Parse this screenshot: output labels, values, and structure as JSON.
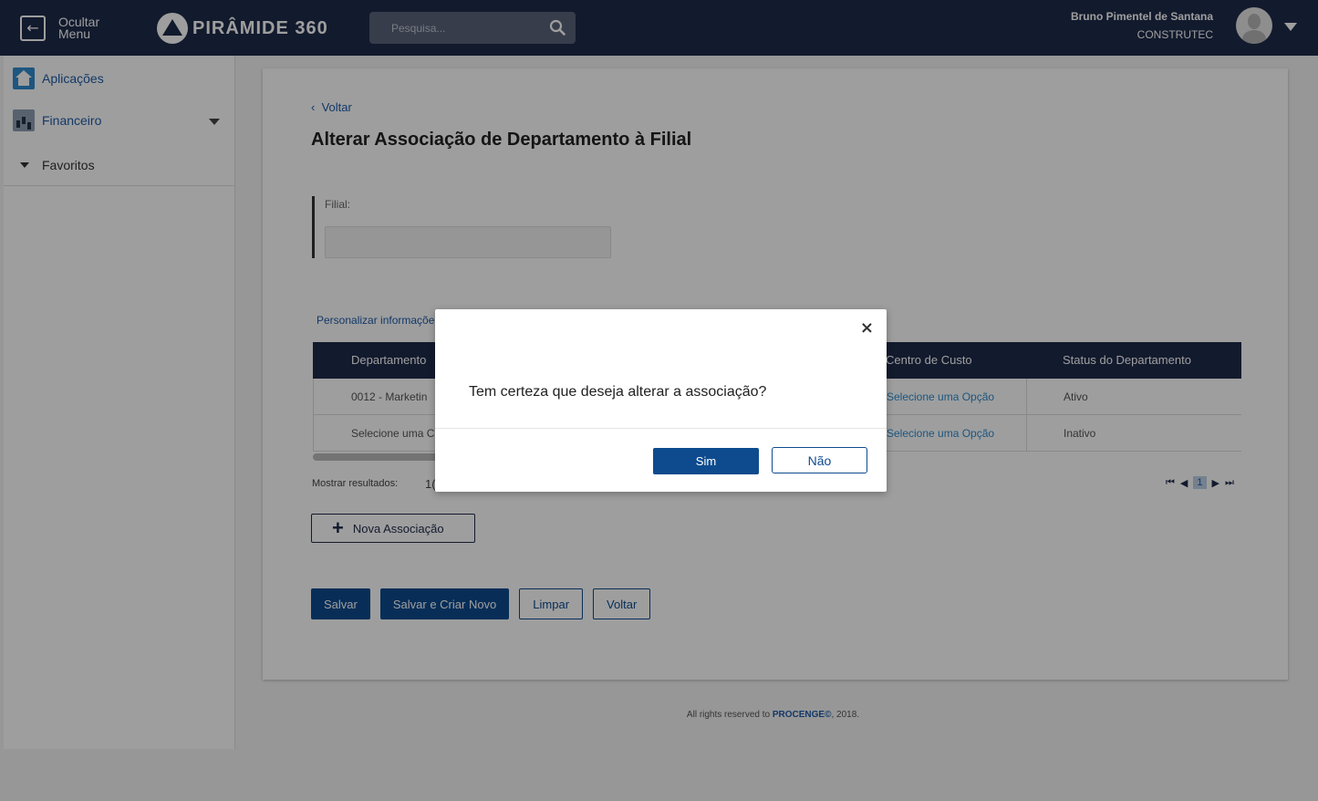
{
  "topbar": {
    "hide_menu_label_1": "Ocultar",
    "hide_menu_label_2": "Menu",
    "logo_text": "PIRÂMIDE 360",
    "search_placeholder": "Pesquisa...",
    "user_name": "Bruno Pimentel de Santana",
    "company": "CONSTRUTEC"
  },
  "sidebar": {
    "items": [
      {
        "label": "Aplicações",
        "icon": "home-icon"
      },
      {
        "label": "Financeiro",
        "icon": "finance-chart-icon"
      }
    ],
    "favorites": "Favoritos"
  },
  "page": {
    "back_label": "Voltar",
    "title": "Alterar Associação de Departamento à Filial",
    "filial_label": "Filial:",
    "filial_value": "",
    "customize_label": "Personalizar informaçõe",
    "columns": [
      "Departamento",
      "Centro de Custo",
      "Status do Departamento"
    ],
    "rows": [
      {
        "department": "0012 - Marketin",
        "cost_center": "Selecione uma Opção",
        "status": "Ativo"
      },
      {
        "department": "Selecione uma C",
        "cost_center": "Selecione uma Opção",
        "status": "Inativo"
      }
    ],
    "show_results_label": "Mostrar resultados:",
    "show_results_value": "1(",
    "current_page": "1",
    "add_button": "Nova Associação",
    "buttons": {
      "save": "Salvar",
      "save_new": "Salvar e Criar Novo",
      "clear": "Limpar",
      "back": "Voltar"
    }
  },
  "footer": {
    "text_before": "All rights reserved to ",
    "brand": "PROCENGE©",
    "text_after": ", 2018."
  },
  "modal": {
    "message": "Tem certeza que deseja alterar a associação?",
    "yes": "Sim",
    "no": "Não",
    "close": "×"
  },
  "colors": {
    "topbar": "#1e2a4a",
    "primary": "#0d4b8e",
    "link": "#1f5ba8"
  }
}
